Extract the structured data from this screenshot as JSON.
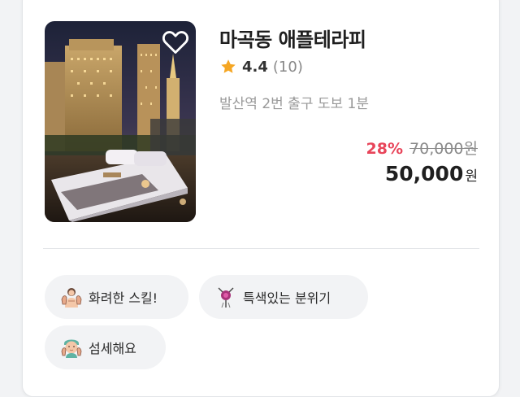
{
  "listing": {
    "title": "마곡동 애플테라피",
    "rating_score": "4.4",
    "rating_count": "(10)",
    "location": "발산역 2번 출구 도보 1분",
    "discount": "28%",
    "original_price": "70,000원",
    "final_price": "50,000",
    "final_unit": "원",
    "favorite": false,
    "icons": {
      "favorite": "heart-outline-icon",
      "rating": "star-icon"
    }
  },
  "tags": [
    {
      "label": "화려한 스킬!",
      "icon": "massage-hands-icon"
    },
    {
      "label": "특색있는 분위기",
      "icon": "tassel-ornament-icon"
    },
    {
      "label": "섬세해요",
      "icon": "facial-care-icon"
    }
  ],
  "colors": {
    "discount": "#e8455a",
    "star": "#f5a623",
    "chip_bg": "#f2f3f5",
    "muted_text": "#999999"
  }
}
